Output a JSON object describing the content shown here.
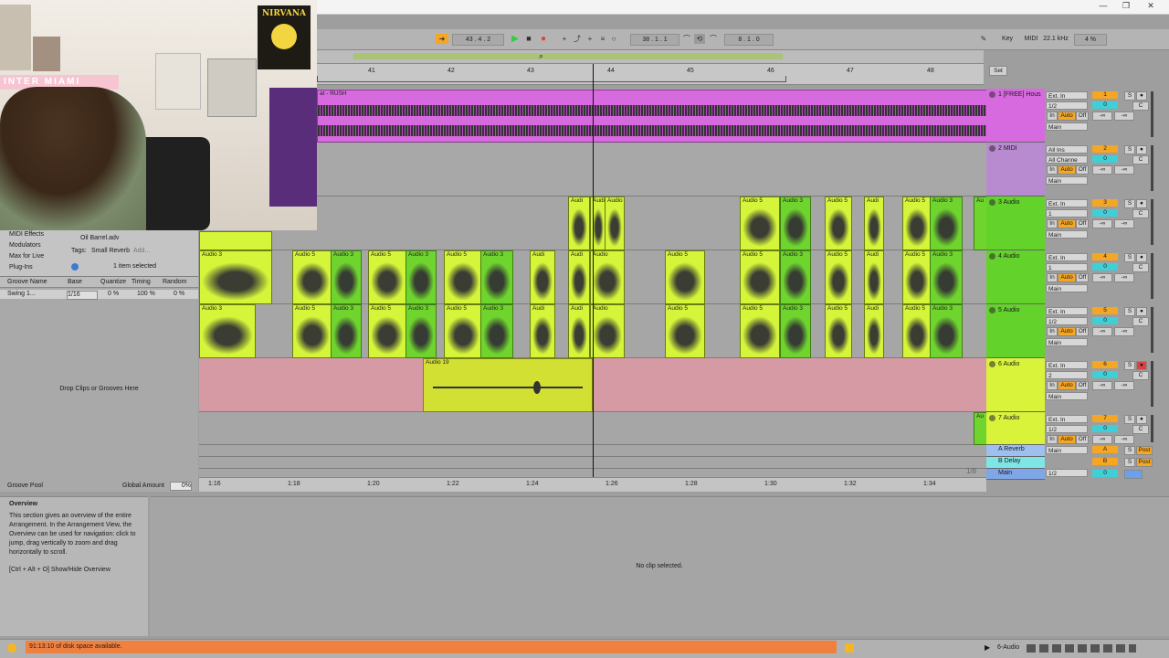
{
  "transport": {
    "tempo_nudge": "43 . 4 . 2",
    "position": "38 . 1 . 1",
    "loop_length": "8 . 1 . 0",
    "key_label": "Key",
    "midi_label": "MIDI",
    "sample_rate": "22.1 kHz",
    "cpu": "4 %"
  },
  "ruler": {
    "bars": [
      "41",
      "42",
      "43",
      "44",
      "45",
      "46",
      "47",
      "48"
    ],
    "set_label": "Set"
  },
  "tracks": [
    {
      "name": "1 [FREE] Hous",
      "input": "Ext. In",
      "channel": "1/2",
      "monitor": [
        "In",
        "Auto",
        "Off"
      ],
      "output": "Main",
      "number": "1",
      "vol": "0",
      "pan": "C",
      "sends": [
        "-∞",
        "-∞"
      ],
      "color": "#d86ae0"
    },
    {
      "name": "2 MIDI",
      "input": "All Ins",
      "channel": "All Channe",
      "monitor": [
        "In",
        "Auto",
        "Off"
      ],
      "output": "Main",
      "number": "2",
      "vol": "0",
      "pan": "C",
      "sends": [
        "-∞",
        "-∞"
      ],
      "color": "#b88ad0"
    },
    {
      "name": "3 Audio",
      "input": "Ext. In",
      "channel": "1",
      "monitor": [
        "In",
        "Auto",
        "Off"
      ],
      "output": "Main",
      "number": "3",
      "vol": "0",
      "pan": "C",
      "sends": [
        "-∞",
        "-∞"
      ],
      "color": "#63d22a"
    },
    {
      "name": "4 Audio",
      "input": "Ext. In",
      "channel": "1",
      "monitor": [
        "In",
        "Auto",
        "Off"
      ],
      "output": "Main",
      "number": "4",
      "vol": "0",
      "pan": "C",
      "sends": [
        "-∞",
        "-∞"
      ],
      "color": "#63d22a"
    },
    {
      "name": "5 Audio",
      "input": "Ext. In",
      "channel": "1/2",
      "monitor": [
        "In",
        "Auto",
        "Off"
      ],
      "output": "Main",
      "number": "5",
      "vol": "0",
      "pan": "C",
      "sends": [
        "-∞",
        "-∞"
      ],
      "color": "#63d22a"
    },
    {
      "name": "6 Audio",
      "input": "Ext. In",
      "channel": "2",
      "monitor": [
        "In",
        "Auto",
        "Off"
      ],
      "output": "Main",
      "number": "6",
      "vol": "0",
      "pan": "C",
      "sends": [
        "-∞",
        "-∞"
      ],
      "color": "#d9f33b"
    },
    {
      "name": "7 Audio",
      "input": "Ext. In",
      "channel": "1/2",
      "monitor": [
        "In",
        "Auto",
        "Off"
      ],
      "output": "Main",
      "number": "7",
      "vol": "0",
      "pan": "C",
      "sends": [
        "-∞",
        "-∞"
      ],
      "color": "#d9f33b"
    }
  ],
  "returns": [
    {
      "name": "A Reverb",
      "letter": "A",
      "post": "Post"
    },
    {
      "name": "B Delay",
      "letter": "B",
      "post": "Post"
    },
    {
      "name": "Main",
      "channel": "1/2",
      "vol": "0"
    }
  ],
  "clips": {
    "track1": "at - RUSH",
    "audio3": "Audio 3",
    "audio5": "Audio 5",
    "audio19": "Audio 19",
    "short_au": "Audi",
    "short_au2": "Audio",
    "short_au3": "Au"
  },
  "browser": {
    "items": [
      "MIDI Effects",
      "Modulators",
      "Max for Live",
      "Plug-Ins"
    ],
    "file": "Oil Barrel.adv",
    "tags_label": "Tags:",
    "tag": "Small Reverb",
    "add": "Add...",
    "selection": "1 item selected"
  },
  "groove": {
    "headers": [
      "Groove Name",
      "Base",
      "Quantize",
      "Timing",
      "Random"
    ],
    "row": {
      "name": "Swing 1...",
      "base": "1/16",
      "quantize": "0 %",
      "timing": "100 %",
      "random": "0 %"
    },
    "drop_hint": "Drop Clips or Grooves Here",
    "pool_label": "Groove Pool",
    "global_amount_label": "Global Amount",
    "global_amount": "0%"
  },
  "info": {
    "title": "Overview",
    "body": "This section gives an overview of the entire Arrangement. In the Arrangement View, the Overview can be used for navigation: click to jump, drag vertically to zoom and drag horizontally to scroll.",
    "shortcut": "[Ctrl + Alt + O] Show/Hide Overview"
  },
  "clipview": {
    "empty": "No clip selected."
  },
  "timeline": [
    "1:16",
    "1:18",
    "1:20",
    "1:22",
    "1:24",
    "1:26",
    "1:28",
    "1:30",
    "1:32",
    "1:34"
  ],
  "zoom": "1/8",
  "status": {
    "disk": "91:13:10 of disk space available.",
    "track": "6-Audio"
  },
  "webcam": {
    "poster_text": "NIRVANA",
    "banner_text": "INTER MIAMI"
  }
}
